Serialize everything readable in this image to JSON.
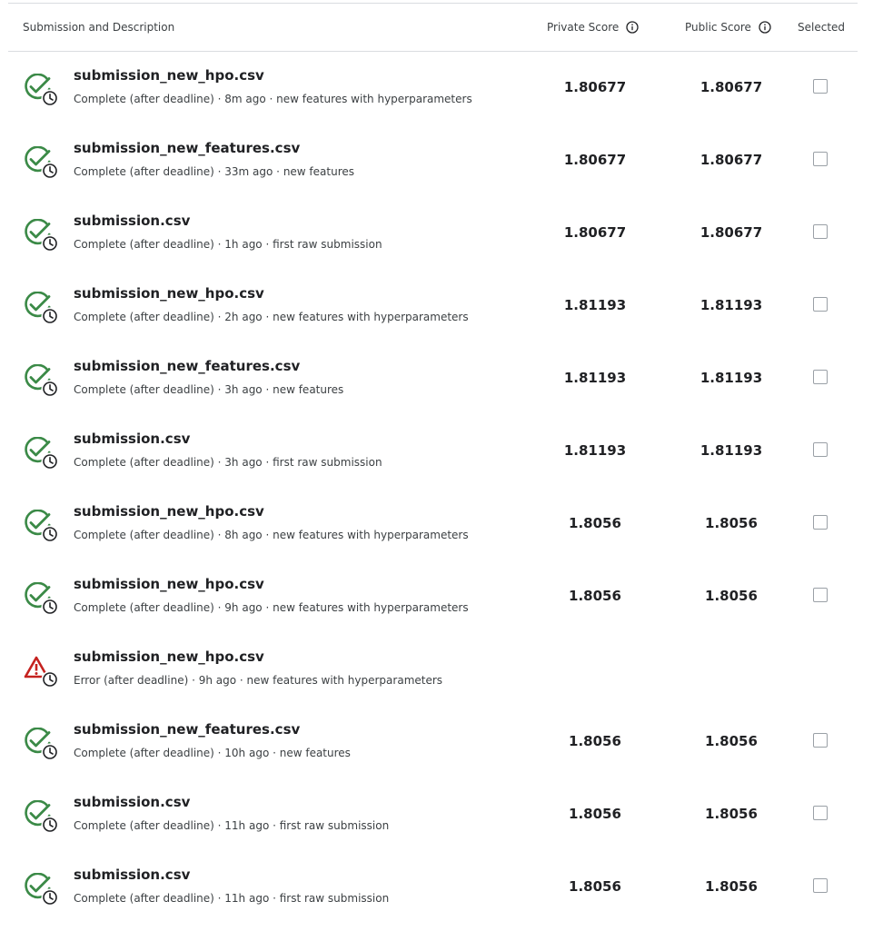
{
  "header": {
    "submission_label": "Submission and Description",
    "private_label": "Private Score",
    "public_label": "Public Score",
    "selected_label": "Selected"
  },
  "colors": {
    "success": "#3b8a47",
    "error": "#c5221f",
    "clock": "#202124"
  },
  "rows": [
    {
      "status": "complete",
      "file": "submission_new_hpo.csv",
      "desc": "Complete (after deadline) · 8m ago · new features with hyperparameters",
      "private": "1.80677",
      "public": "1.80677",
      "selectable": true
    },
    {
      "status": "complete",
      "file": "submission_new_features.csv",
      "desc": "Complete (after deadline) · 33m ago · new features",
      "private": "1.80677",
      "public": "1.80677",
      "selectable": true
    },
    {
      "status": "complete",
      "file": "submission.csv",
      "desc": "Complete (after deadline) · 1h ago · first raw submission",
      "private": "1.80677",
      "public": "1.80677",
      "selectable": true
    },
    {
      "status": "complete",
      "file": "submission_new_hpo.csv",
      "desc": "Complete (after deadline) · 2h ago · new features with hyperparameters",
      "private": "1.81193",
      "public": "1.81193",
      "selectable": true
    },
    {
      "status": "complete",
      "file": "submission_new_features.csv",
      "desc": "Complete (after deadline) · 3h ago · new features",
      "private": "1.81193",
      "public": "1.81193",
      "selectable": true
    },
    {
      "status": "complete",
      "file": "submission.csv",
      "desc": "Complete (after deadline) · 3h ago · first raw submission",
      "private": "1.81193",
      "public": "1.81193",
      "selectable": true
    },
    {
      "status": "complete",
      "file": "submission_new_hpo.csv",
      "desc": "Complete (after deadline) · 8h ago · new features with hyperparameters",
      "private": "1.8056",
      "public": "1.8056",
      "selectable": true
    },
    {
      "status": "complete",
      "file": "submission_new_hpo.csv",
      "desc": "Complete (after deadline) · 9h ago · new features with hyperparameters",
      "private": "1.8056",
      "public": "1.8056",
      "selectable": true
    },
    {
      "status": "error",
      "file": "submission_new_hpo.csv",
      "desc": "Error (after deadline) · 9h ago · new features with hyperparameters",
      "private": "",
      "public": "",
      "selectable": false
    },
    {
      "status": "complete",
      "file": "submission_new_features.csv",
      "desc": "Complete (after deadline) · 10h ago · new features",
      "private": "1.8056",
      "public": "1.8056",
      "selectable": true
    },
    {
      "status": "complete",
      "file": "submission.csv",
      "desc": "Complete (after deadline) · 11h ago · first raw submission",
      "private": "1.8056",
      "public": "1.8056",
      "selectable": true
    },
    {
      "status": "complete",
      "file": "submission.csv",
      "desc": "Complete (after deadline) · 11h ago · first raw submission",
      "private": "1.8056",
      "public": "1.8056",
      "selectable": true
    }
  ]
}
